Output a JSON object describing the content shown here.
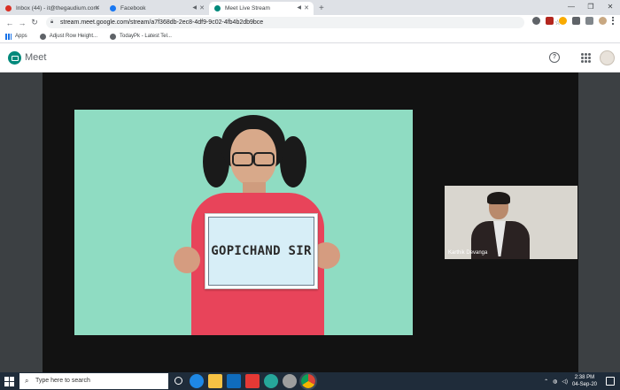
{
  "browser": {
    "tabs": [
      {
        "label": "Inbox (44) - it@thegaudium.com",
        "favicon_color": "#d93025"
      },
      {
        "label": "Facebook",
        "favicon_color": "#1877f2"
      },
      {
        "label": "Meet Live Stream",
        "favicon_color": "#00897b"
      }
    ],
    "new_tab_label": "+",
    "url": "stream.meet.google.com/stream/a7f368db-2ec8-4df9-9c02-4fb4b2db9bce",
    "bookmarks": [
      {
        "label": "Apps"
      },
      {
        "label": "Adjust Row Height..."
      },
      {
        "label": "TodayPk - Latest Tel..."
      }
    ]
  },
  "meet": {
    "title": "Meet",
    "help_label": "?",
    "brand_color": "#00897b"
  },
  "stream": {
    "sign_text": "GOPICHAND SIR",
    "presenter_name": "Karthik Devanga"
  },
  "taskbar": {
    "search_placeholder": "Type here to search",
    "time": "2:38 PM",
    "date": "04-Sep-20"
  }
}
